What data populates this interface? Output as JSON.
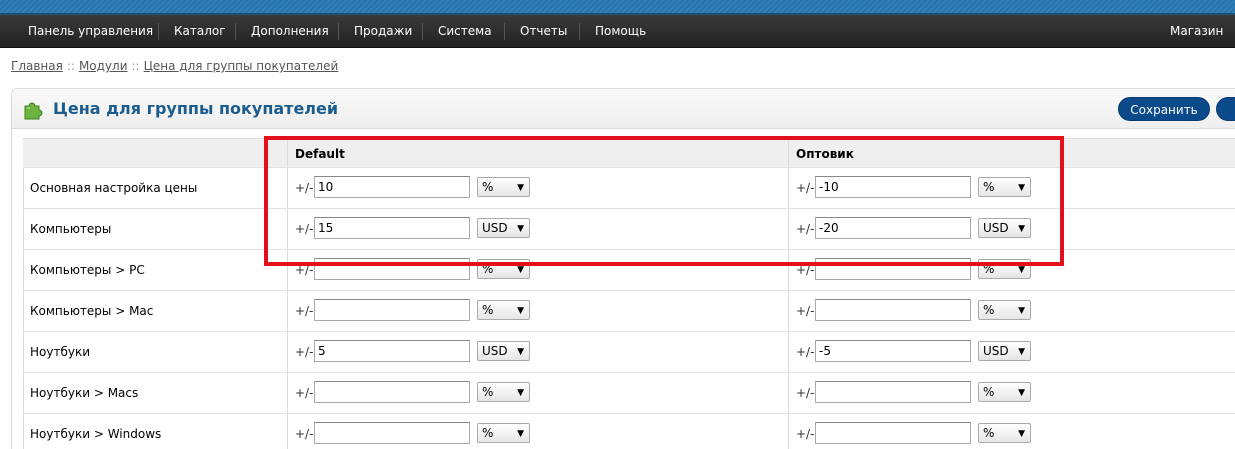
{
  "menu": {
    "items": [
      "Панель управления",
      "Каталог",
      "Дополнения",
      "Продажи",
      "Система",
      "Отчеты",
      "Помощь"
    ],
    "store_link": "Магазин"
  },
  "breadcrumb": {
    "items": [
      "Главная",
      "Модули",
      "Цена для группы покупателей"
    ],
    "separator": "::"
  },
  "panel": {
    "title": "Цена для группы покупателей",
    "save_label": "Сохранить",
    "icon": "puzzle-icon"
  },
  "table": {
    "columns": [
      "Default",
      "Оптовик"
    ],
    "prefix": "+/-",
    "rows": [
      {
        "label": "Основная настройка цены",
        "default": {
          "value": "10",
          "type": "%"
        },
        "opt": {
          "value": "-10",
          "type": "%"
        }
      },
      {
        "label": "Компьютеры",
        "default": {
          "value": "15",
          "type": "USD"
        },
        "opt": {
          "value": "-20",
          "type": "USD"
        }
      },
      {
        "label": "Компьютеры > PC",
        "default": {
          "value": "",
          "type": "%"
        },
        "opt": {
          "value": "",
          "type": "%"
        }
      },
      {
        "label": "Компьютеры > Mac",
        "default": {
          "value": "",
          "type": "%"
        },
        "opt": {
          "value": "",
          "type": "%"
        }
      },
      {
        "label": "Ноутбуки",
        "default": {
          "value": "5",
          "type": "USD"
        },
        "opt": {
          "value": "-5",
          "type": "USD"
        }
      },
      {
        "label": "Ноутбуки > Macs",
        "default": {
          "value": "",
          "type": "%"
        },
        "opt": {
          "value": "",
          "type": "%"
        }
      },
      {
        "label": "Ноутбуки > Windows",
        "default": {
          "value": "",
          "type": "%"
        },
        "opt": {
          "value": "",
          "type": "%"
        }
      }
    ]
  },
  "colors": {
    "menu_bg": "#2b2b2b",
    "accent": "#1b5c8e",
    "button": "#0b4a8a",
    "highlight": "#e3101a"
  }
}
